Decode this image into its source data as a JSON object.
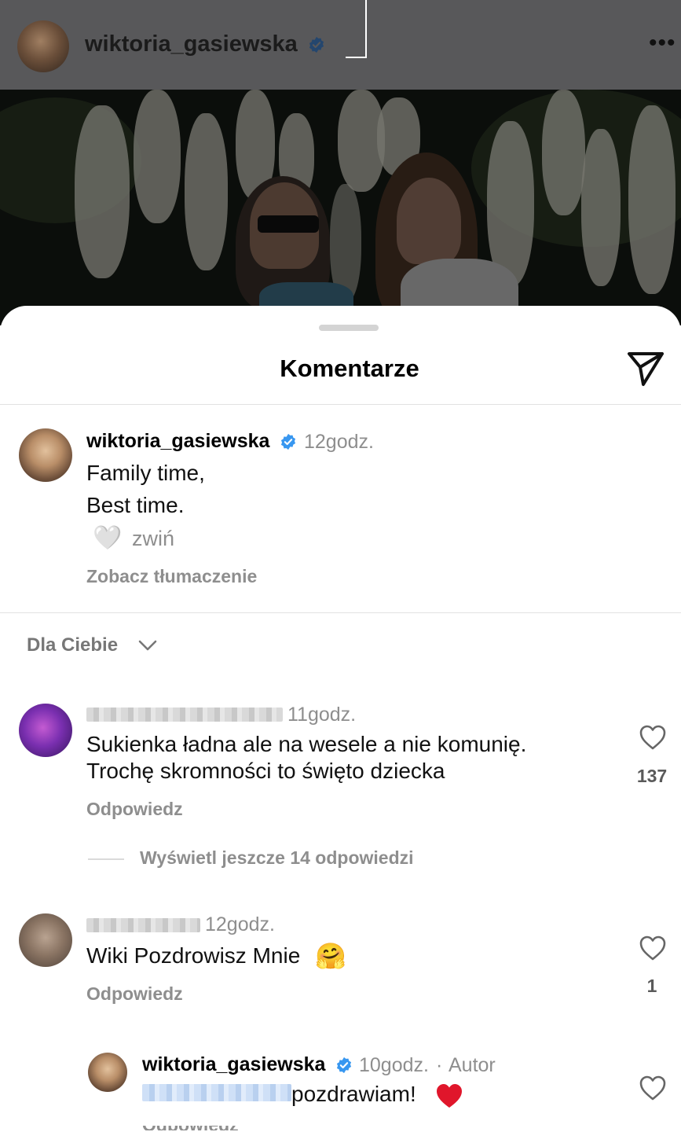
{
  "post": {
    "username": "wiktoria_gasiewska",
    "more_icon": "more-horizontal-icon"
  },
  "sheet": {
    "title": "Komentarze",
    "share_icon": "paper-plane-icon"
  },
  "caption": {
    "username": "wiktoria_gasiewska",
    "time": "12godz.",
    "line1": "Family time,",
    "line2": "Best time.",
    "emoji": "🤍",
    "collapse": "zwiń",
    "translate": "Zobacz tłumaczenie"
  },
  "sort": {
    "label": "Dla Ciebie",
    "icon": "chevron-down-icon"
  },
  "comments": [
    {
      "time": "11godz.",
      "text_line1": "Sukienka ładna ale na wesele a nie komunię.",
      "text_line2": "Trochę skromności to święto dziecka",
      "reply": "Odpowiedz",
      "likes": "137",
      "view_replies": "Wyświetl jeszcze 14 odpowiedzi"
    },
    {
      "time": "12godz.",
      "text": "Wiki Pozdrowisz Mnie",
      "emoji": "🤗",
      "reply": "Odpowiedz",
      "likes": "1"
    }
  ],
  "reply_comment": {
    "username": "wiktoria_gasiewska",
    "time": "10godz.",
    "separator": "·",
    "author_tag": "Autor",
    "text": "pozdrawiam!",
    "emoji": "❤️"
  },
  "colors": {
    "verified_blue": "#3897f0",
    "dim_header": "#58585a",
    "secondary_text": "#8e8e8e",
    "heart_red": "#e0162b"
  }
}
